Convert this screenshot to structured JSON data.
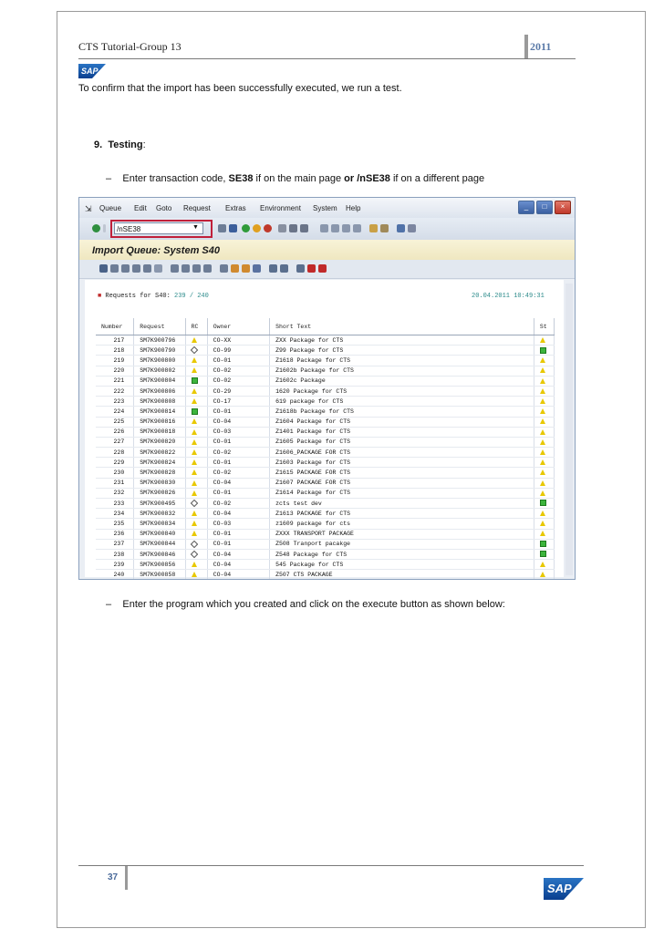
{
  "header": {
    "text": "CTS Tutorial-Group 13",
    "year": "2011"
  },
  "logo": {
    "text": "SAP"
  },
  "intro": "To confirm that the import has been successfully executed, we run a test.",
  "section": {
    "number": "9.",
    "title": "Testing",
    "suffix": ":"
  },
  "bullet1": {
    "dash": "–",
    "pre": "Enter transaction code, ",
    "b1": "SE38",
    "mid": " if on the main page ",
    "b2": "or /nSE38",
    "post": " if on a different page"
  },
  "bullet2": {
    "dash": "–",
    "text": "Enter the program which you created and click on the execute button as shown below:"
  },
  "sap": {
    "menu": [
      "Queue",
      "Edit",
      "Goto",
      "Request",
      "Extras",
      "Environment",
      "System",
      "Help"
    ],
    "command_value": "/nSE38",
    "screen_title": "Import Queue: System S40",
    "req_label": "Requests for S40:",
    "req_count": "239 / 240",
    "datetime": "20.04.2011 10:49:31",
    "columns": [
      "Number",
      "Request",
      "RC",
      "Owner",
      "Short Text",
      "St"
    ],
    "rows": [
      {
        "num": "217",
        "req": "SM7K900796",
        "rc": "tri",
        "owner": "CO-XX",
        "text": "ZXX Package for CTS",
        "st": "tri"
      },
      {
        "num": "218",
        "req": "SM7K900790",
        "rc": "dia",
        "owner": "CO-99",
        "text": "Z99 Package for CTS",
        "st": "sq"
      },
      {
        "num": "219",
        "req": "SM7K900800",
        "rc": "tri",
        "owner": "CO-01",
        "text": "Z1618 Package for CTS",
        "st": "tri"
      },
      {
        "num": "220",
        "req": "SM7K900802",
        "rc": "tri",
        "owner": "CO-02",
        "text": "Z1602b Package for CTS",
        "st": "tri"
      },
      {
        "num": "221",
        "req": "SM7K900804",
        "rc": "sq",
        "owner": "CO-02",
        "text": "Z1602c Package",
        "st": "tri"
      },
      {
        "num": "222",
        "req": "SM7K900806",
        "rc": "tri",
        "owner": "CO-29",
        "text": "1620 Package for CTS",
        "st": "tri"
      },
      {
        "num": "223",
        "req": "SM7K900808",
        "rc": "tri",
        "owner": "CO-17",
        "text": "619 package for CTS",
        "st": "tri"
      },
      {
        "num": "224",
        "req": "SM7K900814",
        "rc": "sq",
        "owner": "CO-01",
        "text": "Z1618b Package for CTS",
        "st": "tri"
      },
      {
        "num": "225",
        "req": "SM7K900816",
        "rc": "tri",
        "owner": "CO-04",
        "text": "Z1604 Package for CTS",
        "st": "tri"
      },
      {
        "num": "226",
        "req": "SM7K900818",
        "rc": "tri",
        "owner": "CO-03",
        "text": "Z1401 Package for CTS",
        "st": "tri"
      },
      {
        "num": "227",
        "req": "SM7K900820",
        "rc": "tri",
        "owner": "CO-01",
        "text": "Z1605 Package for CTS",
        "st": "tri"
      },
      {
        "num": "228",
        "req": "SM7K900822",
        "rc": "tri",
        "owner": "CO-02",
        "text": "Z1606_PACKAGE FOR CTS",
        "st": "tri"
      },
      {
        "num": "229",
        "req": "SM7K900824",
        "rc": "tri",
        "owner": "CO-01",
        "text": "Z1603 Package for CTS",
        "st": "tri"
      },
      {
        "num": "230",
        "req": "SM7K900828",
        "rc": "tri",
        "owner": "CO-02",
        "text": "Z1615 PACKAGE FOR CTS",
        "st": "tri"
      },
      {
        "num": "231",
        "req": "SM7K900830",
        "rc": "tri",
        "owner": "CO-04",
        "text": "Z1607 PACKAGE FOR CTS",
        "st": "tri"
      },
      {
        "num": "232",
        "req": "SM7K900826",
        "rc": "tri",
        "owner": "CO-01",
        "text": "Z1614 Package for CTS",
        "st": "tri"
      },
      {
        "num": "233",
        "req": "SM7K900495",
        "rc": "dia",
        "owner": "CO-02",
        "text": "zcts test dev",
        "st": "sq"
      },
      {
        "num": "234",
        "req": "SM7K900832",
        "rc": "tri",
        "owner": "CO-04",
        "text": "Z1613 PACKAGE for CTS",
        "st": "tri"
      },
      {
        "num": "235",
        "req": "SM7K900834",
        "rc": "tri",
        "owner": "CO-03",
        "text": "z1609 package for cts",
        "st": "tri"
      },
      {
        "num": "236",
        "req": "SM7K900840",
        "rc": "tri",
        "owner": "CO-01",
        "text": "ZXXX TRANSPORT PACKAGE",
        "st": "tri"
      },
      {
        "num": "237",
        "req": "SM7K900844",
        "rc": "dia",
        "owner": "CO-01",
        "text": "Z508 Tranport pacakge",
        "st": "sq"
      },
      {
        "num": "238",
        "req": "SM7K900846",
        "rc": "dia",
        "owner": "CO-04",
        "text": "Z548 Package for CTS",
        "st": "sq"
      },
      {
        "num": "239",
        "req": "SM7K900856",
        "rc": "tri",
        "owner": "CO-04",
        "text": "545 Package for CTS",
        "st": "tri"
      },
      {
        "num": "240",
        "req": "SM7K900858",
        "rc": "tri",
        "owner": "CO-04",
        "text": "Z507 CTS PACKAGE",
        "st": "tri"
      }
    ]
  },
  "footer": {
    "page": "37"
  }
}
